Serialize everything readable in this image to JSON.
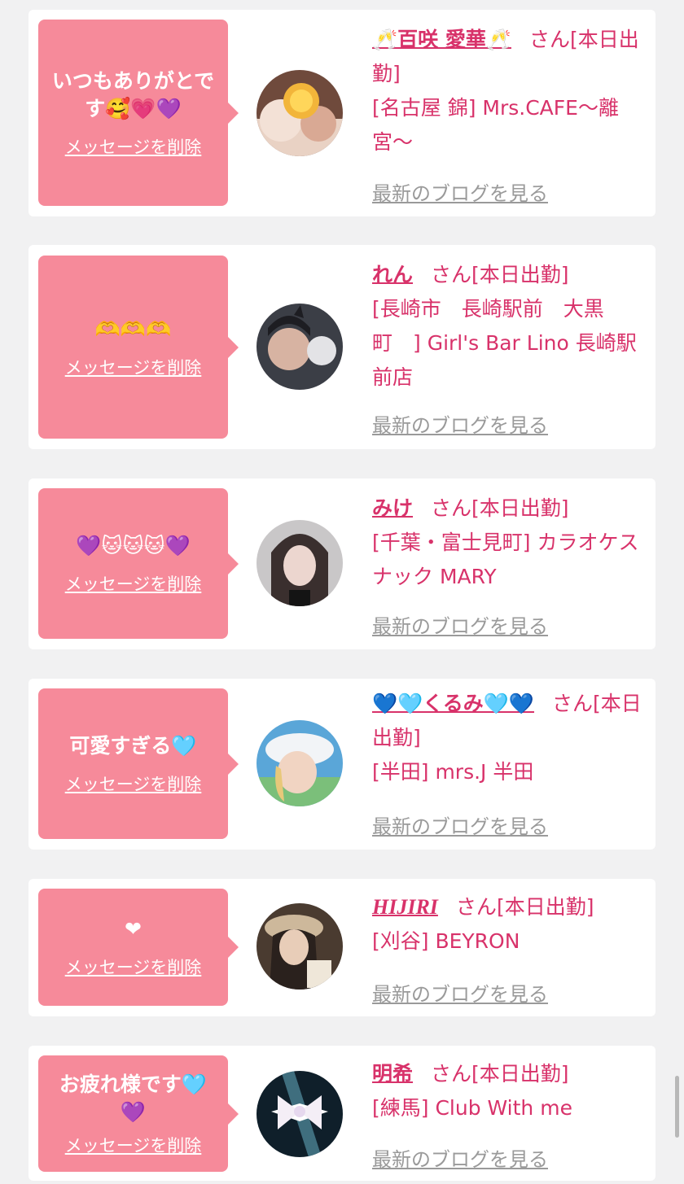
{
  "delete_label": "メッセージを削除",
  "blog_label": "最新のブログを見る",
  "cards": [
    {
      "message": "いつもありがとです🥰💗💜",
      "name": "🥂百咲 愛華🥂",
      "san": "さん",
      "status": "[本日出勤]",
      "shop": "[名古屋 錦] Mrs.CAFE〜離宮〜"
    },
    {
      "message": "🫶🫶🫶",
      "name": "れん",
      "san": "さん",
      "status": "[本日出勤]",
      "shop": "[長崎市　長崎駅前　大黒町　] Girl's Bar Lino 長崎駅前店"
    },
    {
      "message": "💜🐱🐱🐱💜",
      "name": "みけ",
      "san": "さん",
      "status": "[本日出勤]",
      "shop": "[千葉・富士見町] カラオケスナック MARY"
    },
    {
      "message": "可愛すぎる🩵",
      "name": "💙🩵くるみ🩵💙",
      "san": "さん",
      "status": "[本日出勤]",
      "shop": "[半田] mrs.J 半田"
    },
    {
      "message": "❤",
      "name": "HIJIRI",
      "san": "さん",
      "status": "[本日出勤]",
      "shop": "[刈谷] BEYRON"
    },
    {
      "message": "お疲れ様です🩵💜",
      "name": "明希",
      "san": "さん",
      "status": "[本日出勤]",
      "shop": "[練馬] Club With me"
    }
  ],
  "colors": {
    "bubble": "#f68a9a",
    "accent": "#d8326a",
    "link_gray": "#9a9a9a",
    "background": "#f1f1f2"
  }
}
